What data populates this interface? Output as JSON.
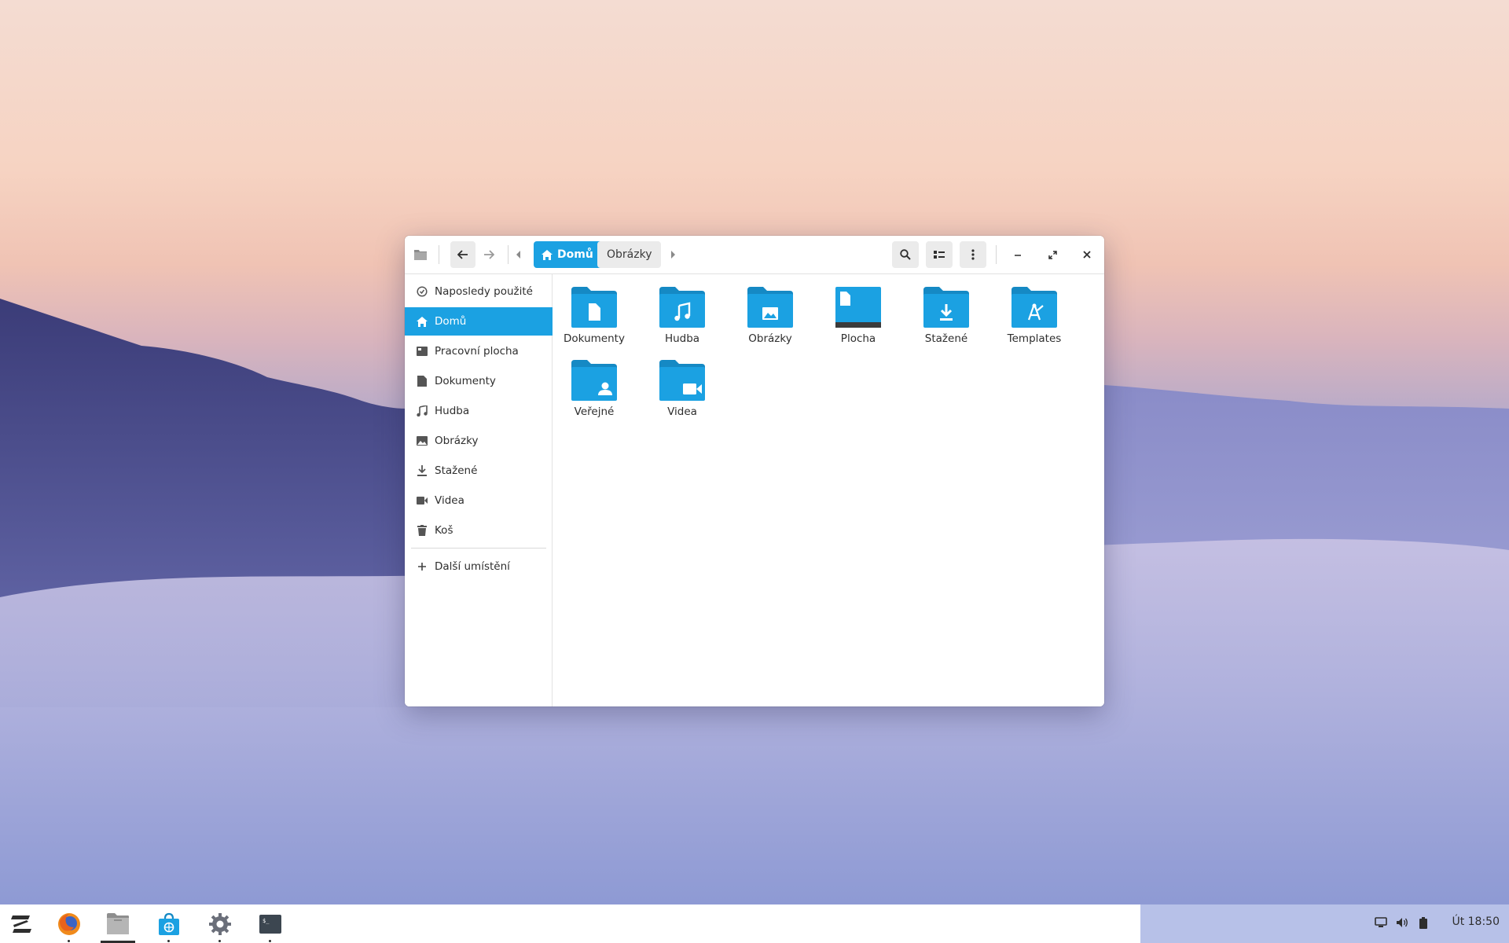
{
  "window": {
    "toolbar": {
      "back_label": "←",
      "forward_label": "→",
      "breadcrumb_home": "Domů",
      "breadcrumb_next": "Obrázky"
    },
    "sidebar": {
      "items": [
        {
          "label": "Naposledy použité",
          "icon": "clock-icon"
        },
        {
          "label": "Domů",
          "icon": "home-icon",
          "selected": true
        },
        {
          "label": "Pracovní plocha",
          "icon": "desktop-icon"
        },
        {
          "label": "Dokumenty",
          "icon": "document-icon"
        },
        {
          "label": "Hudba",
          "icon": "music-icon"
        },
        {
          "label": "Obrázky",
          "icon": "image-icon"
        },
        {
          "label": "Stažené",
          "icon": "download-icon"
        },
        {
          "label": "Videa",
          "icon": "video-icon"
        },
        {
          "label": "Koš",
          "icon": "trash-icon"
        }
      ],
      "other_locations": "Další umístění"
    },
    "folders": [
      {
        "label": "Dokumenty",
        "icon": "documents-folder-icon"
      },
      {
        "label": "Hudba",
        "icon": "music-folder-icon"
      },
      {
        "label": "Obrázky",
        "icon": "pictures-folder-icon"
      },
      {
        "label": "Plocha",
        "icon": "desktop-folder-icon"
      },
      {
        "label": "Stažené",
        "icon": "downloads-folder-icon"
      },
      {
        "label": "Templates",
        "icon": "templates-folder-icon"
      },
      {
        "label": "Veřejné",
        "icon": "public-folder-icon"
      },
      {
        "label": "Videa",
        "icon": "videos-folder-icon"
      }
    ]
  },
  "taskbar": {
    "apps": [
      "zorin-menu-icon",
      "firefox-icon",
      "files-icon",
      "software-store-icon",
      "settings-icon",
      "terminal-icon"
    ],
    "clock": "Út 18:50"
  },
  "colors": {
    "accent": "#1ba1e2",
    "folder_body": "#1ba1e2",
    "folder_tab": "#1589c4"
  }
}
